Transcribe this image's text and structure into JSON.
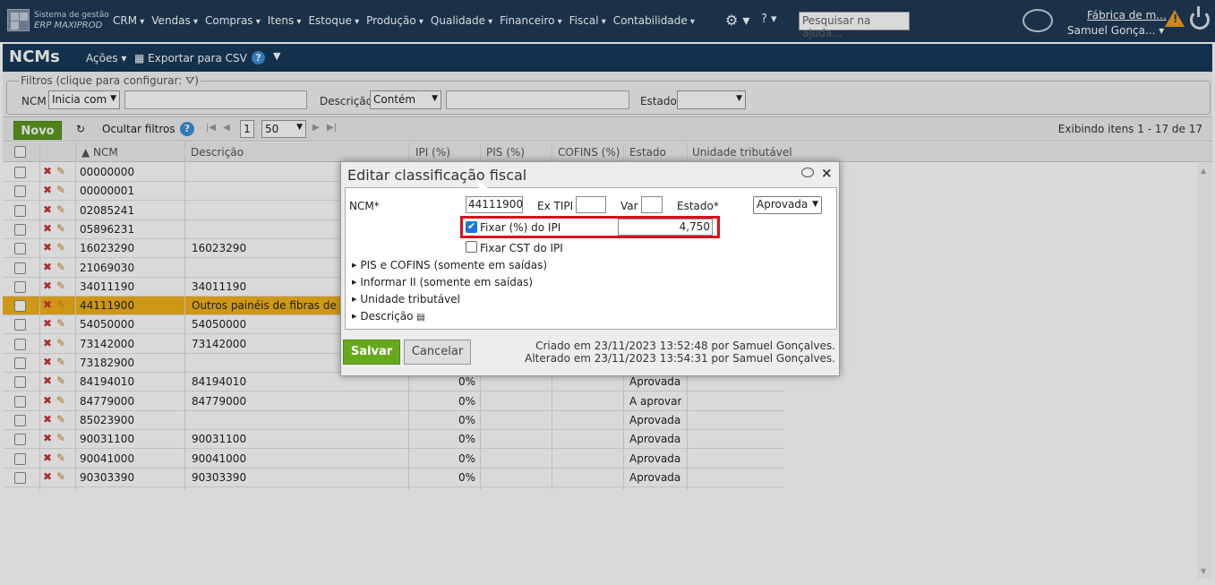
{
  "brand": {
    "line1": "Sistema de gestão",
    "line2": "ERP MAXIPROD"
  },
  "menu": [
    "CRM",
    "Vendas",
    "Compras",
    "Itens",
    "Estoque",
    "Produção",
    "Qualidade",
    "Financeiro",
    "Fiscal",
    "Contabilidade"
  ],
  "search": {
    "placeholder": "Pesquisar na ajuda..."
  },
  "account": {
    "company": "Fábrica de m...",
    "user": "Samuel Gonça..."
  },
  "page": {
    "title": "NCMs",
    "actions": "Ações",
    "export": "Exportar para CSV",
    "help": "?"
  },
  "filters": {
    "legend": "Filtros (clique para configurar:",
    "ncm_label": "NCM",
    "ncm_mode": "Inicia com",
    "desc_label": "Descrição",
    "desc_mode": "Contém",
    "estado_label": "Estado"
  },
  "toolbar": {
    "novo": "Novo",
    "ocultar": "Ocultar filtros",
    "page": "1",
    "per_page": "50",
    "range": "Exibindo itens 1 - 17 de 17"
  },
  "columns": {
    "ncm": "▲ NCM",
    "descricao": "Descrição",
    "ipi": "IPI (%)",
    "pis": "PIS (%)",
    "cofins": "COFINS (%)",
    "estado": "Estado",
    "unidade": "Unidade tributável"
  },
  "rows": [
    {
      "ncm": "00000000",
      "desc": "",
      "ipi": "",
      "estado": ""
    },
    {
      "ncm": "00000001",
      "desc": "",
      "ipi": "",
      "estado": ""
    },
    {
      "ncm": "02085241",
      "desc": "",
      "ipi": "",
      "estado": ""
    },
    {
      "ncm": "05896231",
      "desc": "",
      "ipi": "",
      "estado": ""
    },
    {
      "ncm": "16023290",
      "desc": "16023290",
      "ipi": "",
      "estado": ""
    },
    {
      "ncm": "21069030",
      "desc": "",
      "ipi": "",
      "estado": ""
    },
    {
      "ncm": "34011190",
      "desc": "34011190",
      "ipi": "",
      "estado": ""
    },
    {
      "ncm": "44111900",
      "desc": "Outros painéis de fibras de ma",
      "ipi": "",
      "estado": ""
    },
    {
      "ncm": "54050000",
      "desc": "54050000",
      "ipi": "",
      "estado": ""
    },
    {
      "ncm": "73142000",
      "desc": "73142000",
      "ipi": "",
      "estado": ""
    },
    {
      "ncm": "73182900",
      "desc": "",
      "ipi": "",
      "estado": ""
    },
    {
      "ncm": "84194010",
      "desc": "84194010",
      "ipi": "0%",
      "estado": "Aprovada"
    },
    {
      "ncm": "84779000",
      "desc": "84779000",
      "ipi": "0%",
      "estado": "A aprovar"
    },
    {
      "ncm": "85023900",
      "desc": "",
      "ipi": "0%",
      "estado": "Aprovada"
    },
    {
      "ncm": "90031100",
      "desc": "90031100",
      "ipi": "0%",
      "estado": "Aprovada"
    },
    {
      "ncm": "90041000",
      "desc": "90041000",
      "ipi": "0%",
      "estado": "Aprovada"
    },
    {
      "ncm": "90303390",
      "desc": "90303390",
      "ipi": "0%",
      "estado": "Aprovada"
    }
  ],
  "modal": {
    "title": "Editar classificação fiscal",
    "ncm_label": "NCM*",
    "ncm_value": "44111900",
    "extipi_label": "Ex TIPI",
    "var_label": "Var",
    "estado_label": "Estado*",
    "estado_value": "Aprovada",
    "fixar_ipi_label": "Fixar (%) do IPI",
    "fixar_ipi_value": "4,750",
    "fixar_cst_label": "Fixar CST do IPI",
    "sections": [
      "PIS e COFINS (somente em saídas)",
      "Informar II (somente em saídas)",
      "Unidade tributável",
      "Descrição"
    ],
    "save": "Salvar",
    "cancel": "Cancelar",
    "created": "Criado em 23/11/2023 13:52:48 por Samuel Gonçalves.",
    "altered": "Alterado em 23/11/2023 13:54:31 por Samuel Gonçalves."
  }
}
